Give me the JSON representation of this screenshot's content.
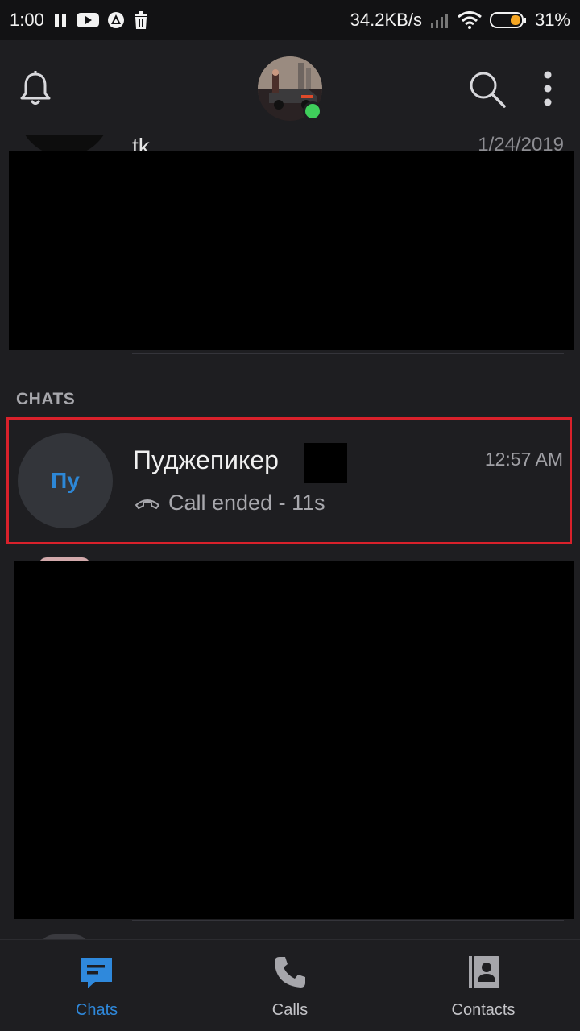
{
  "status_bar": {
    "time": "1:00",
    "network_speed": "34.2KB/s",
    "battery": "31%",
    "icons": [
      "pause-icon",
      "youtube-icon",
      "app-icon",
      "trash-icon",
      "signal-icon",
      "wifi-icon",
      "battery-icon"
    ]
  },
  "header": {
    "icons": [
      "bell-icon",
      "search-icon",
      "more-vert-icon"
    ],
    "online_color": "#3fcf5b"
  },
  "list": {
    "partial_row": {
      "name": "tk",
      "date": "1/24/2019"
    },
    "section_label": "CHATS",
    "chats": [
      {
        "initials": "Пу",
        "name": "Пуджепикер",
        "time": "12:57 AM",
        "preview_icon": "call-ended-icon",
        "preview": "Call ended - 11s",
        "highlight_color": "#d9212b"
      }
    ]
  },
  "bottom_nav": {
    "accent": "#2f89dc",
    "items": [
      {
        "label": "Chats",
        "icon": "chat-icon",
        "active": true
      },
      {
        "label": "Calls",
        "icon": "phone-icon",
        "active": false
      },
      {
        "label": "Contacts",
        "icon": "contacts-icon",
        "active": false
      }
    ]
  }
}
